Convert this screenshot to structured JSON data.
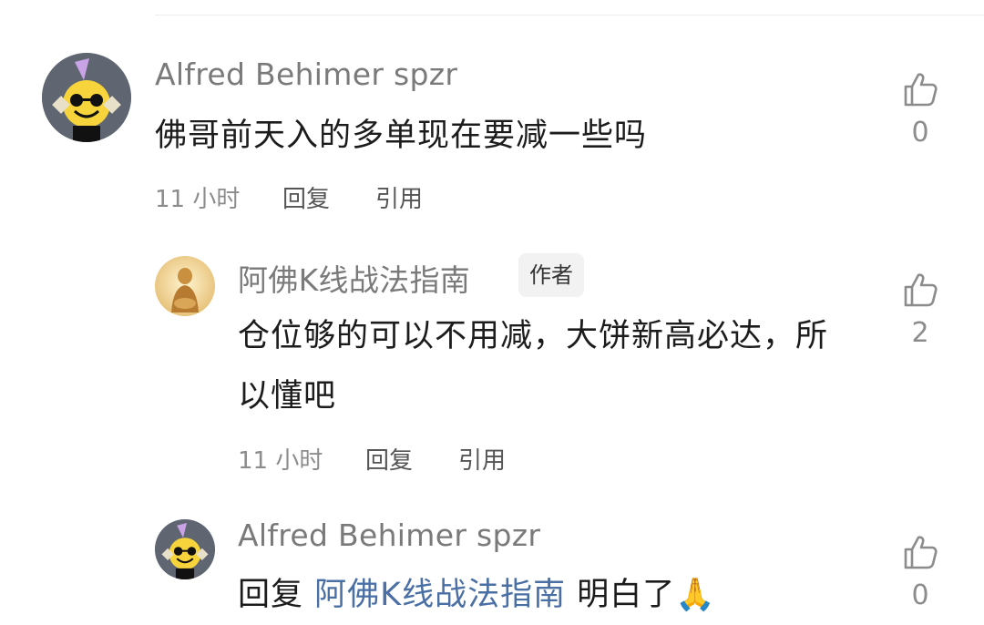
{
  "comments": [
    {
      "author": "Alfred Behimer spzr",
      "content": "佛哥前天入的多单现在要减一些吗",
      "time": "11 小时",
      "reply_label": "回复",
      "quote_label": "引用",
      "likes": "0"
    },
    {
      "author": "阿佛K线战法指南",
      "badge": "作者",
      "content_line1": "仓位够的可以不用减，大饼新高必达，所",
      "content_line2": "以懂吧",
      "time": "11 小时",
      "reply_label": "回复",
      "quote_label": "引用",
      "likes": "2"
    },
    {
      "author": "Alfred Behimer spzr",
      "reply_prefix": "回复",
      "reply_mention": "阿佛K线战法指南",
      "content": "明白了🙏",
      "likes": "0"
    }
  ]
}
